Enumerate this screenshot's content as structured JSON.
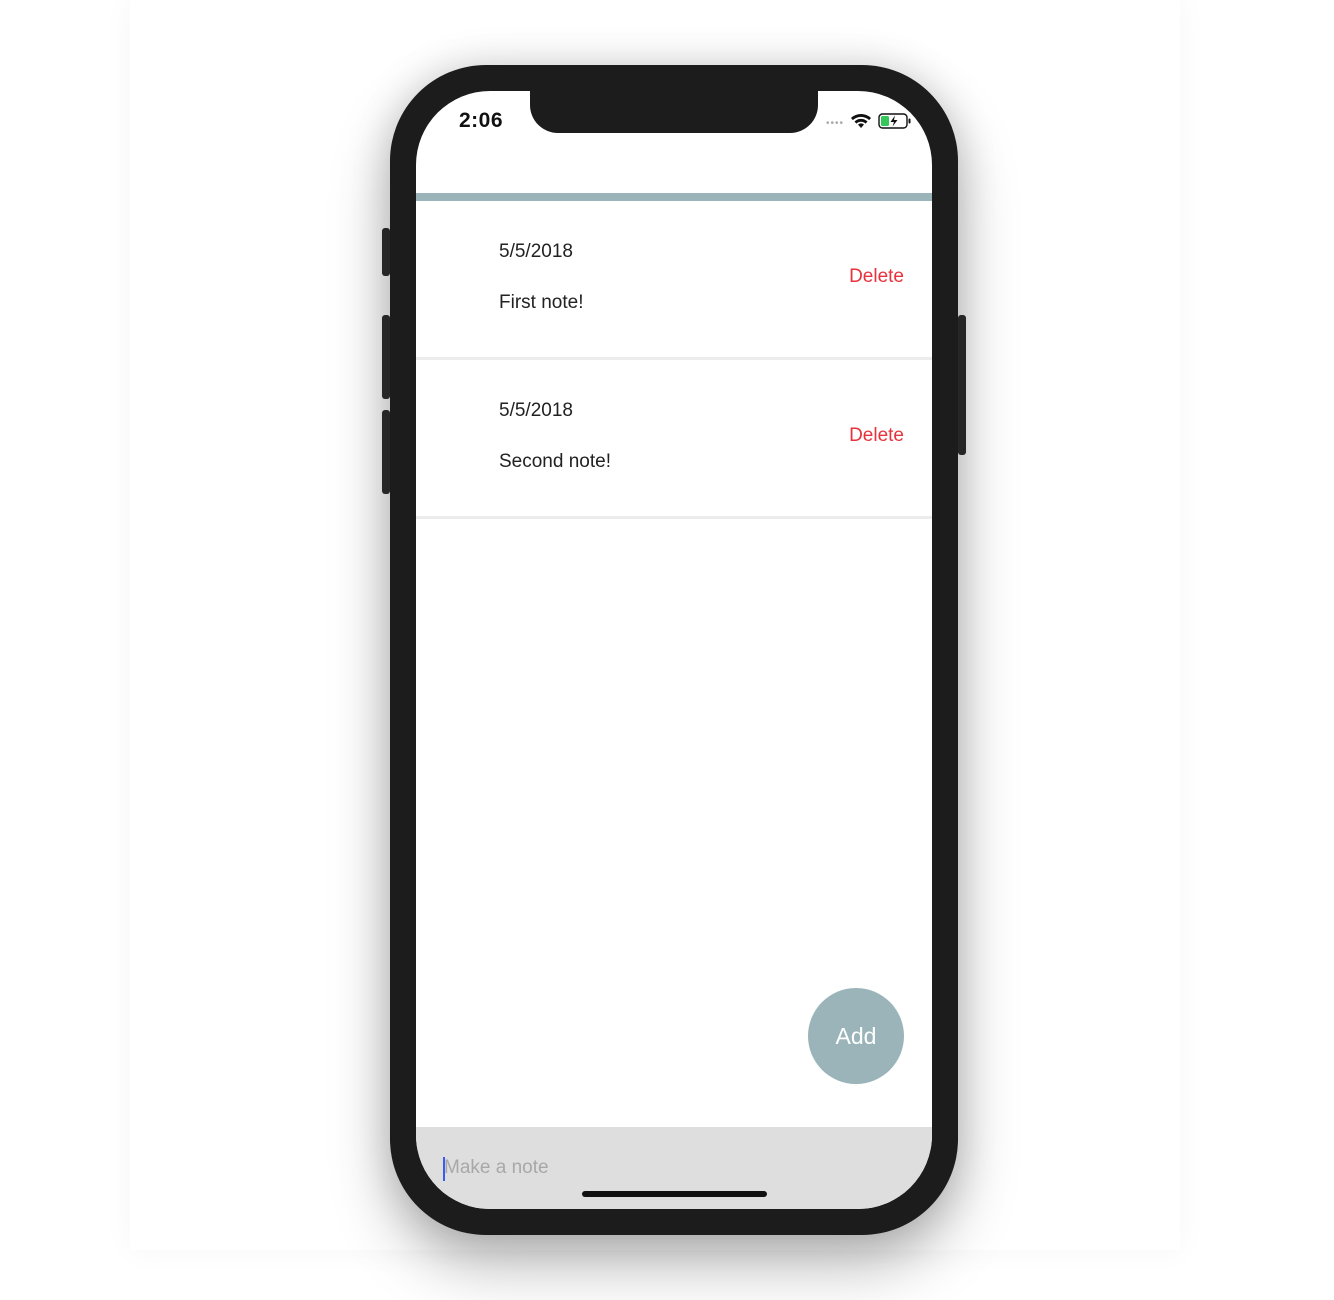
{
  "status_bar": {
    "time": "2:06",
    "signal_icon": "cellular-dots-icon",
    "wifi_icon": "wifi-icon",
    "battery_icon": "battery-charging-icon"
  },
  "colors": {
    "accent": "#9ab4b9",
    "delete": "#e8323c",
    "input_bar": "#dedede"
  },
  "notes": [
    {
      "date": "5/5/2018",
      "text": "First note!",
      "delete_label": "Delete"
    },
    {
      "date": "5/5/2018",
      "text": "Second note!",
      "delete_label": "Delete"
    }
  ],
  "add_button": {
    "label": "Add"
  },
  "input": {
    "placeholder": "Make a note",
    "value": ""
  }
}
